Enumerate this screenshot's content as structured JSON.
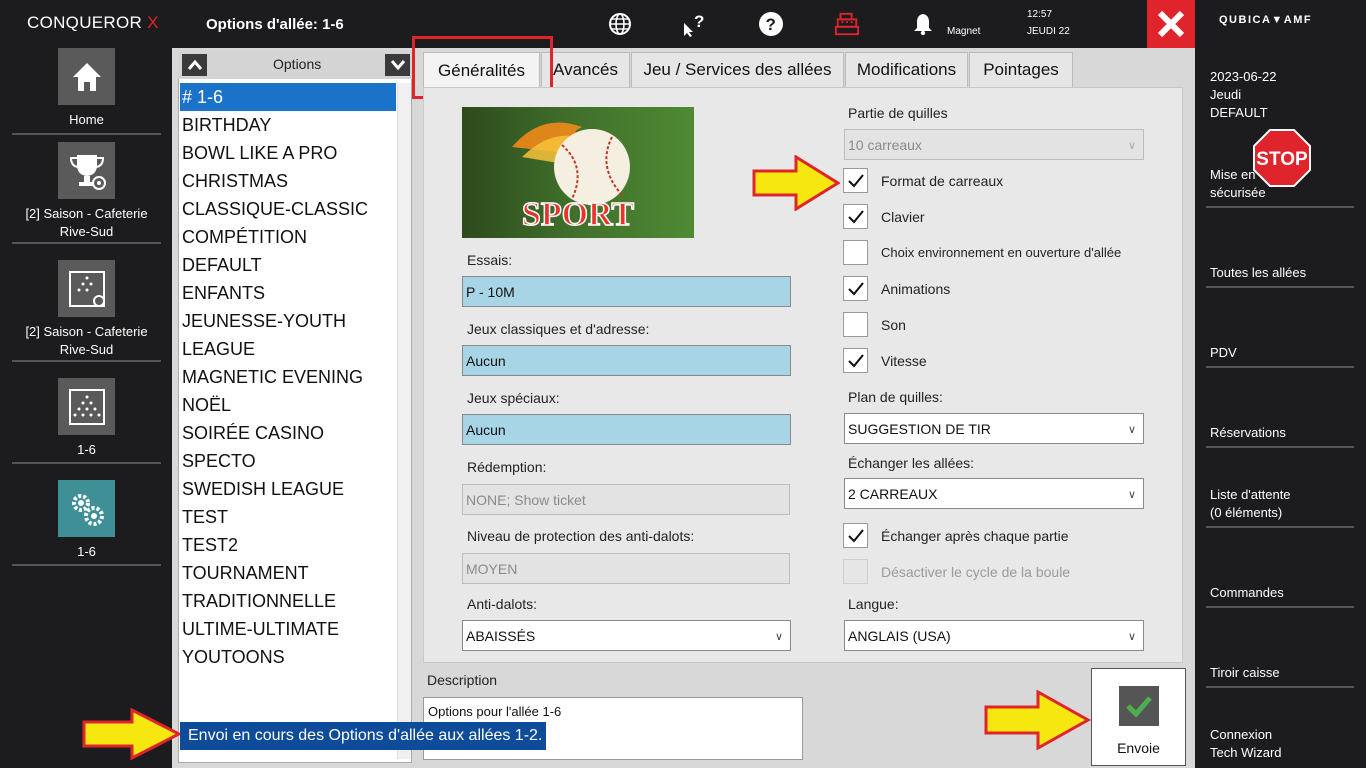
{
  "brand": {
    "name": "CONQUEROR",
    "x": "X"
  },
  "left_nav": [
    {
      "label": "Home"
    },
    {
      "label": "[2] Saison - Cafeterie Rive-Sud"
    },
    {
      "label": "[2] Saison - Cafeterie Rive-Sud"
    },
    {
      "label": "1-6"
    },
    {
      "label": "1-6"
    }
  ],
  "header": {
    "title": "Options d'allée: 1-6",
    "user": "Magnet",
    "time": "12:57",
    "day": "JEUDI 22"
  },
  "right": {
    "logo": "QUBICA▼AMF",
    "date": "2023-06-22",
    "weekday": "Jeudi",
    "profile": "DEFAULT",
    "items": [
      {
        "line1": "Mise en",
        "line2": "sécurisée"
      },
      {
        "line1": "Toutes les allées"
      },
      {
        "line1": "PDV"
      },
      {
        "line1": "Réservations"
      },
      {
        "line1": "Liste d'attente",
        "line2": "(0 éléments)"
      },
      {
        "line1": "Commandes"
      },
      {
        "line1": "Tiroir caisse"
      },
      {
        "line1": "Connexion",
        "line2": "Tech Wizard"
      }
    ],
    "stop": "STOP"
  },
  "options": {
    "header": "Options",
    "items": [
      "# 1-6",
      "BIRTHDAY",
      "BOWL LIKE A PRO",
      "CHRISTMAS",
      "CLASSIQUE-CLASSIC",
      "COMPÉTITION",
      "DEFAULT",
      "ENFANTS",
      "JEUNESSE-YOUTH",
      "LEAGUE",
      "MAGNETIC EVENING",
      "NOËL",
      "SOIRÉE CASINO",
      "SPECTO",
      "SWEDISH LEAGUE",
      "TEST",
      "TEST2",
      "TOURNAMENT",
      "TRADITIONNELLE",
      "ULTIME-ULTIMATE",
      "YOUTOONS"
    ]
  },
  "tabs": [
    "Généralités",
    "Avancés",
    "Jeu / Services des allées",
    "Modifications",
    "Pointages"
  ],
  "form": {
    "image_text": "SPORT",
    "essais_label": "Essais:",
    "essais_value": "P - 10M",
    "classiques_label": "Jeux classiques et d'adresse:",
    "classiques_value": "Aucun",
    "speciaux_label": "Jeux spéciaux:",
    "speciaux_value": "Aucun",
    "redemption_label": "Rédemption:",
    "redemption_value": "NONE; Show ticket",
    "protection_label": "Niveau de protection des anti-dalots:",
    "protection_value": "MOYEN",
    "antidalots_label": "Anti-dalots:",
    "antidalots_value": "ABAISSÉS",
    "partie_label": "Partie de quilles",
    "partie_value": "10 carreaux",
    "cb_format": "Format de carreaux",
    "cb_clavier": "Clavier",
    "cb_choix": "Choix environnement en ouverture d'allée",
    "cb_animations": "Animations",
    "cb_son": "Son",
    "cb_vitesse": "Vitesse",
    "plan_label": "Plan de quilles:",
    "plan_value": "SUGGESTION DE TIR",
    "echanger_label": "Échanger les allées:",
    "echanger_value": "2 CARREAUX",
    "cb_echanger_partie": "Échanger après chaque partie",
    "cb_desactiver": "Désactiver le cycle de la boule",
    "langue_label": "Langue:",
    "langue_value": "ANGLAIS (USA)"
  },
  "description": {
    "label": "Description",
    "text": "Options pour l'allée 1-6"
  },
  "send_label": "Envoie",
  "toast": "Envoi en cours des Options d'allée aux allées 1-2.",
  "colors": {
    "accent_red": "#e0242b",
    "field_blue": "#a8d5e5",
    "selection": "#1a73c9",
    "teal": "#3f8f97"
  }
}
